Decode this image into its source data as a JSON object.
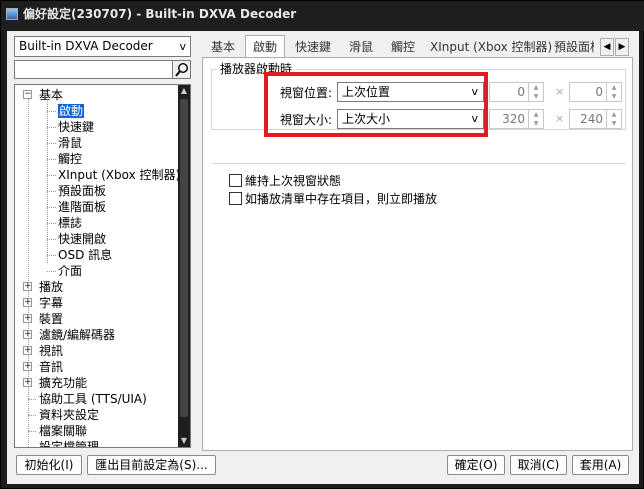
{
  "window": {
    "title": "偏好設定(230707) - Built-in DXVA Decoder"
  },
  "preset": {
    "value": "Built-in DXVA Decoder"
  },
  "search": {
    "value": "",
    "placeholder": ""
  },
  "tree": {
    "items": [
      {
        "label": "基本",
        "level": 0,
        "expanded": true
      },
      {
        "label": "啟動",
        "level": 1,
        "selected": true
      },
      {
        "label": "快速鍵",
        "level": 1
      },
      {
        "label": "滑鼠",
        "level": 1
      },
      {
        "label": "觸控",
        "level": 1
      },
      {
        "label": "XInput (Xbox 控制器)",
        "level": 1
      },
      {
        "label": "預設面板",
        "level": 1
      },
      {
        "label": "進階面板",
        "level": 1
      },
      {
        "label": "標誌",
        "level": 1
      },
      {
        "label": "快速開啟",
        "level": 1
      },
      {
        "label": "OSD 訊息",
        "level": 1
      },
      {
        "label": "介面",
        "level": 1
      },
      {
        "label": "播放",
        "level": 0,
        "expandable": true
      },
      {
        "label": "字幕",
        "level": 0,
        "expandable": true
      },
      {
        "label": "裝置",
        "level": 0,
        "expandable": true
      },
      {
        "label": "濾鏡/編解碼器",
        "level": 0,
        "expandable": true
      },
      {
        "label": "視訊",
        "level": 0,
        "expandable": true
      },
      {
        "label": "音訊",
        "level": 0,
        "expandable": true
      },
      {
        "label": "擴充功能",
        "level": 0,
        "expandable": true
      },
      {
        "label": "協助工具 (TTS/UIA)",
        "level": 0
      },
      {
        "label": "資料夾設定",
        "level": 0
      },
      {
        "label": "檔案關聯",
        "level": 0
      },
      {
        "label": "設定檔管理",
        "level": 0
      }
    ]
  },
  "tabs": [
    "基本",
    "啟動",
    "快速鍵",
    "滑鼠",
    "觸控",
    "XInput (Xbox 控制器)",
    "預設面板"
  ],
  "active_tab": "啟動",
  "startup": {
    "group_title": "播放器啟動時",
    "position_label": "視窗位置:",
    "position_value": "上次位置",
    "position_x": "0",
    "position_y": "0",
    "size_label": "視窗大小:",
    "size_value": "上次大小",
    "size_w": "320",
    "size_h": "240",
    "times": "×",
    "keep_state_label": "維持上次視窗狀態",
    "play_if_list_label": "如播放清單中存在項目，則立即播放"
  },
  "buttons": {
    "reset": "初始化(I)",
    "export": "匯出目前設定為(S)...",
    "ok": "確定(O)",
    "cancel": "取消(C)",
    "apply": "套用(A)"
  },
  "colors": {
    "selection": "#0a64d8",
    "highlight": "#e01b22",
    "title_bg": "#1e1e1e"
  }
}
